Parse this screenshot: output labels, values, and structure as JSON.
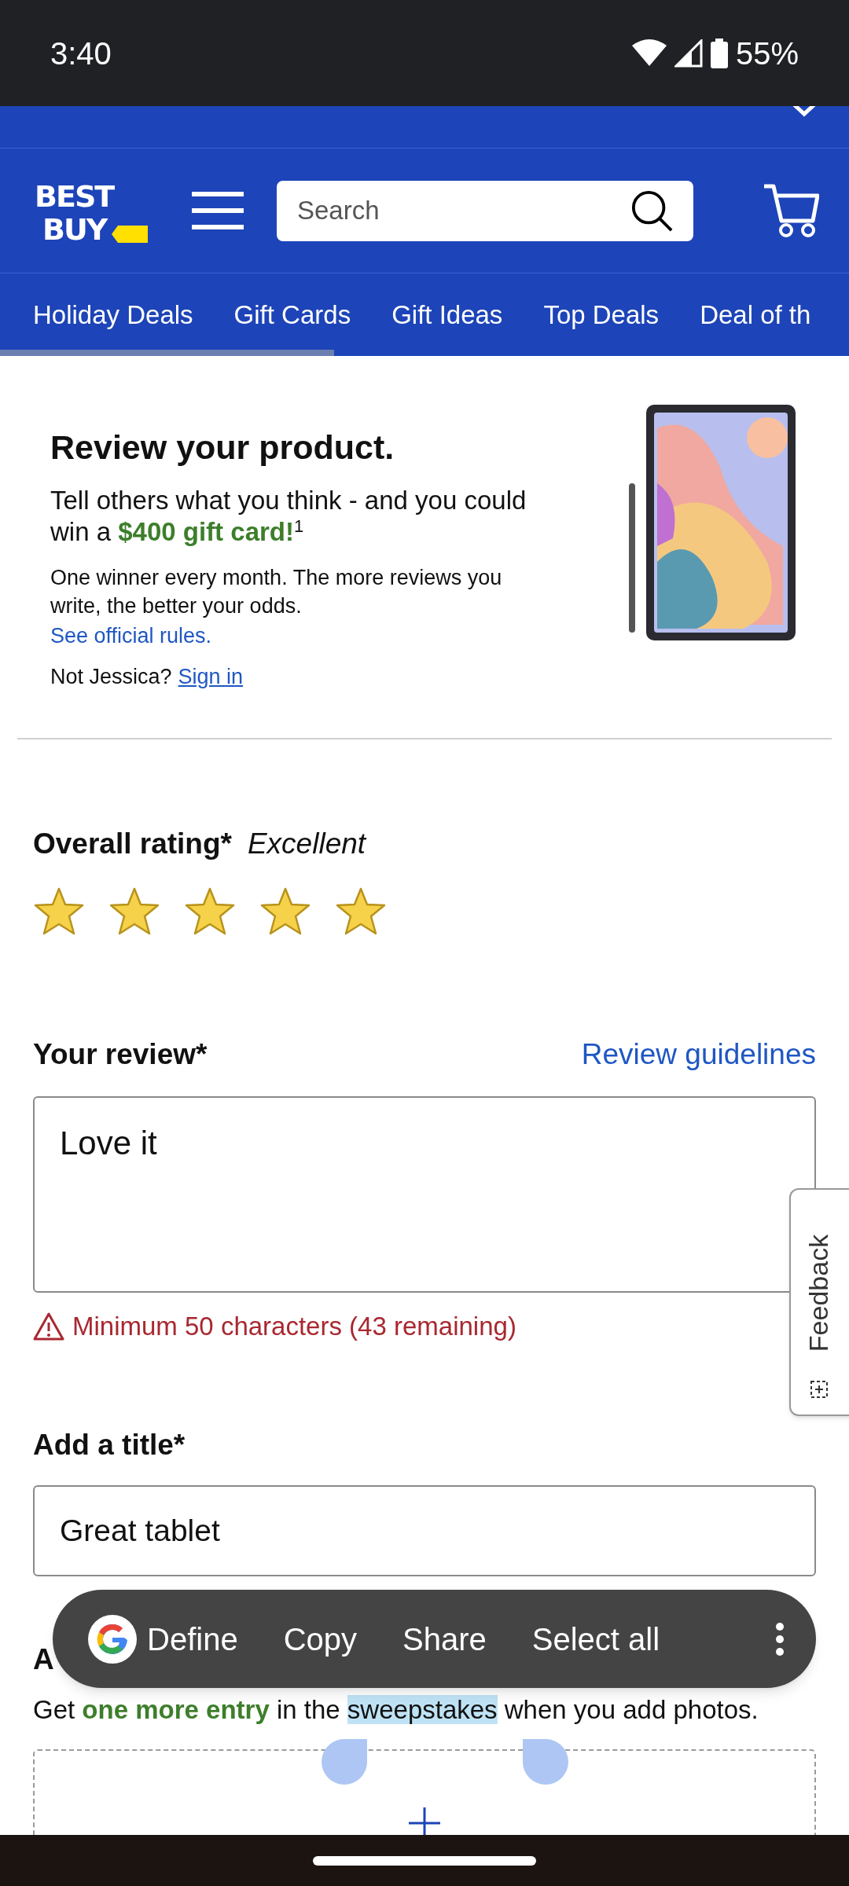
{
  "status_bar": {
    "time": "3:40",
    "battery": "55%"
  },
  "header": {
    "logo": [
      "BEST",
      "BUY"
    ],
    "search_placeholder": "Search"
  },
  "nav_tabs": [
    {
      "label": "Holiday Deals"
    },
    {
      "label": "Gift Cards"
    },
    {
      "label": "Gift Ideas"
    },
    {
      "label": "Top Deals"
    },
    {
      "label": "Deal of th"
    }
  ],
  "promo": {
    "title": "Review your product.",
    "text": "Tell others what you think - and you could win a **$400 gift card!**$^{1}$",
    "details": "One winner every month. The more reviews you write, the better your odds.",
    "rules_link": "See official rules.",
    "not_user": "Not Jessica?",
    "sign_in": "Sign in"
  },
  "rating": {
    "label": "Overall rating*",
    "value": "Excellent",
    "stars": 5
  },
  "review": {
    "label": "Your review*",
    "guidelines_link": "Review guidelines",
    "value": "Love it",
    "error": "Minimum 50 characters (43 remaining)"
  },
  "title_field": {
    "label": "Add a title*",
    "value": "Great tablet"
  },
  "photos": {
    "label": "A",
    "note_before": "Get **one more entry** in the ",
    "note_selected": "sweepstakes",
    "note_after": " when you add photos."
  },
  "feedback_tab": "Feedback",
  "selection_menu": [
    "Define",
    "Copy",
    "Share",
    "Select all"
  ]
}
